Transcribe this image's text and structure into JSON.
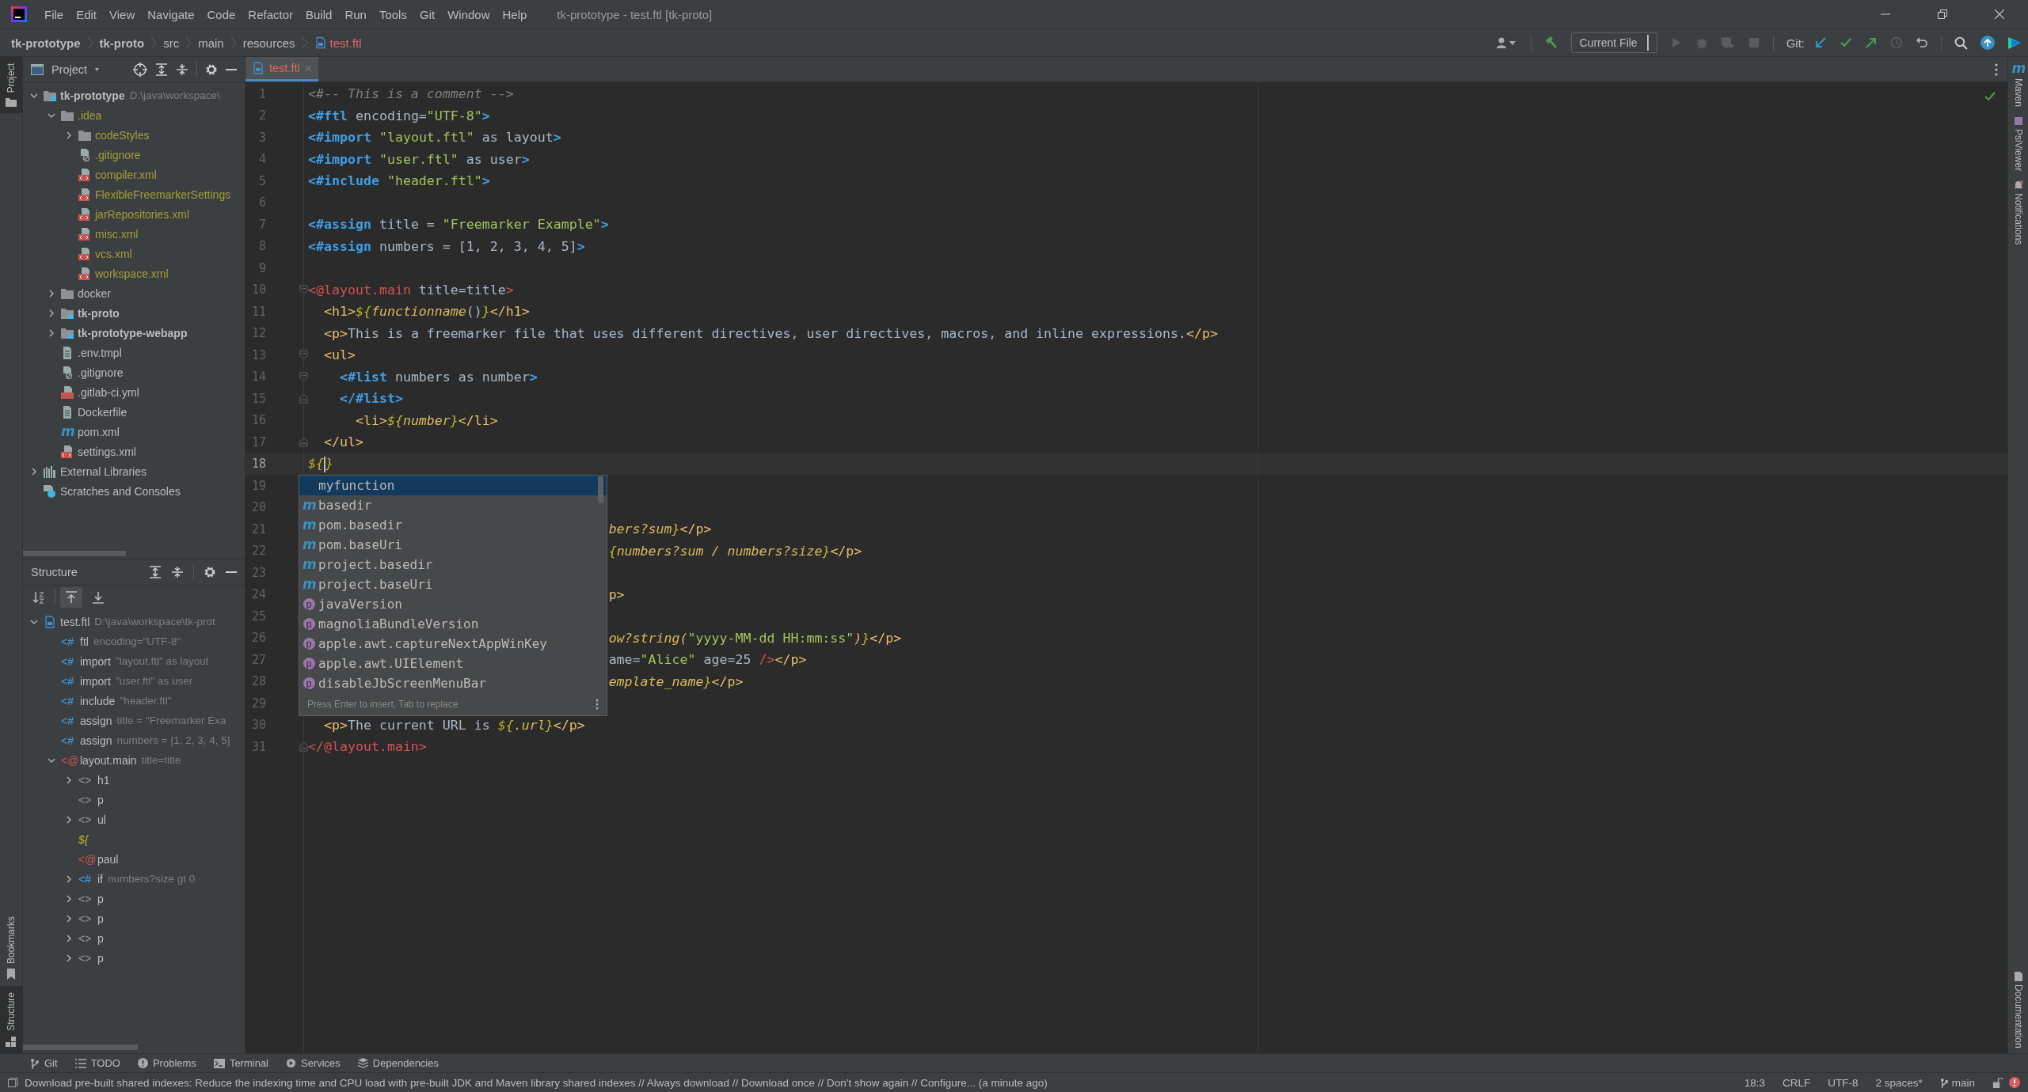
{
  "window": {
    "title": "tk-prototype - test.ftl [tk-proto]"
  },
  "menu": [
    "File",
    "Edit",
    "View",
    "Navigate",
    "Code",
    "Refactor",
    "Build",
    "Run",
    "Tools",
    "Git",
    "Window",
    "Help"
  ],
  "breadcrumb": [
    {
      "label": "tk-prototype",
      "kind": "module"
    },
    {
      "label": "tk-proto",
      "kind": "module"
    },
    {
      "label": "src",
      "kind": "folder"
    },
    {
      "label": "main",
      "kind": "folder"
    },
    {
      "label": "resources",
      "kind": "folder"
    },
    {
      "label": "test.ftl",
      "kind": "file"
    }
  ],
  "toolbar": {
    "run_config": "Current File",
    "git_label": "Git:"
  },
  "left_tool_windows": {
    "top": [
      {
        "label": "Project",
        "selected": true
      }
    ],
    "bottom": [
      {
        "label": "Bookmarks",
        "selected": false
      },
      {
        "label": "Structure",
        "selected": true
      }
    ]
  },
  "right_tool_windows": {
    "top": [
      {
        "label": "Maven",
        "glyph": "m"
      },
      {
        "label": "PsiViewer"
      },
      {
        "label": "Notifications"
      }
    ],
    "bottom": [
      {
        "label": "Documentation"
      }
    ]
  },
  "project": {
    "title": "Project",
    "tree": [
      {
        "label": "tk-prototype",
        "kind": "module",
        "detail": "D:\\java\\workspace\\",
        "expanded": true,
        "children": [
          {
            "label": ".idea",
            "kind": "folder",
            "ignored": true,
            "expanded": true,
            "children": [
              {
                "label": "codeStyles",
                "kind": "folder",
                "ignored": true,
                "expanded": false
              },
              {
                "label": ".gitignore",
                "kind": "gitignore",
                "ignored": true
              },
              {
                "label": "compiler.xml",
                "kind": "xml",
                "ignored": true
              },
              {
                "label": "FlexibleFreemarkerSettings",
                "kind": "xml",
                "ignored": true
              },
              {
                "label": "jarRepositories.xml",
                "kind": "xml",
                "ignored": true
              },
              {
                "label": "misc.xml",
                "kind": "xml",
                "ignored": true
              },
              {
                "label": "vcs.xml",
                "kind": "xml",
                "ignored": true
              },
              {
                "label": "workspace.xml",
                "kind": "xml",
                "ignored": true
              }
            ]
          },
          {
            "label": "docker",
            "kind": "folder",
            "ignored": false,
            "expanded": false
          },
          {
            "label": "tk-proto",
            "kind": "module",
            "expanded": false
          },
          {
            "label": "tk-prototype-webapp",
            "kind": "module",
            "expanded": false
          },
          {
            "label": ".env.tmpl",
            "kind": "file",
            "ignored": false
          },
          {
            "label": ".gitignore",
            "kind": "gitignore",
            "ignored": false
          },
          {
            "label": ".gitlab-ci.yml",
            "kind": "yml",
            "ignored": false
          },
          {
            "label": "Dockerfile",
            "kind": "file",
            "ignored": false
          },
          {
            "label": "pom.xml",
            "kind": "maven",
            "glyph": "m",
            "ignored": false
          },
          {
            "label": "settings.xml",
            "kind": "xml",
            "ignored": false
          }
        ]
      },
      {
        "label": "External Libraries",
        "kind": "libraries",
        "expanded": false
      },
      {
        "label": "Scratches and Consoles",
        "kind": "scratches"
      }
    ]
  },
  "structure": {
    "title": "Structure",
    "toggles": [
      {
        "kind": "sort",
        "selected": false
      },
      {
        "kind": "scroll-from",
        "selected": true
      },
      {
        "kind": "scroll-to",
        "selected": false
      }
    ],
    "tree": [
      {
        "kind": "file",
        "name": "test.ftl",
        "detail": "D:\\java\\workspace\\tk-prot",
        "expanded": true,
        "children": [
          {
            "prefix": "<#",
            "kind": "directive",
            "name": "ftl",
            "detail": "encoding=\"UTF-8\""
          },
          {
            "prefix": "<#",
            "kind": "directive",
            "name": "import",
            "detail": "\"layout.ftl\" as layout"
          },
          {
            "prefix": "<#",
            "kind": "directive",
            "name": "import",
            "detail": "\"user.ftl\" as user"
          },
          {
            "prefix": "<#",
            "kind": "directive",
            "name": "include",
            "detail": "\"header.ftl\""
          },
          {
            "prefix": "<#",
            "kind": "directive",
            "name": "assign",
            "detail": "title = \"Freemarker Exa"
          },
          {
            "prefix": "<#",
            "kind": "directive",
            "name": "assign",
            "detail": "numbers = [1, 2, 3, 4, 5]"
          },
          {
            "prefix": "<@",
            "kind": "macro",
            "name": "layout.main",
            "detail": "title=title",
            "expanded": true,
            "children": [
              {
                "prefix": "<>",
                "kind": "tag",
                "name": "h1",
                "expanded": false
              },
              {
                "prefix": "<>",
                "kind": "tag",
                "name": "p"
              },
              {
                "prefix": "<>",
                "kind": "tag",
                "name": "ul",
                "expanded": false
              },
              {
                "prefix": "${",
                "kind": "interp"
              },
              {
                "prefix": "<@",
                "kind": "macro",
                "name": "paul"
              },
              {
                "prefix": "<#",
                "kind": "directive",
                "name": "if",
                "detail": "numbers?size gt 0",
                "expanded": false
              },
              {
                "prefix": "<>",
                "kind": "tag",
                "name": "p",
                "expanded": false
              },
              {
                "prefix": "<>",
                "kind": "tag",
                "name": "p",
                "expanded": false
              },
              {
                "prefix": "<>",
                "kind": "tag",
                "name": "p",
                "expanded": false
              },
              {
                "prefix": "<>",
                "kind": "tag",
                "name": "p",
                "expanded": false
              }
            ]
          }
        ]
      }
    ]
  },
  "editor": {
    "tabs": [
      {
        "label": "test.ftl",
        "selected": true
      }
    ],
    "lines": [
      {
        "number": "1",
        "current": false,
        "segments": [
          {
            "kind": "comment",
            "text": "<#-- This is a comment -->"
          }
        ]
      },
      {
        "number": "2",
        "current": false,
        "segments": [
          {
            "kind": "directive",
            "text": "<#ftl"
          },
          {
            "kind": "plain",
            "text": " encoding="
          },
          {
            "kind": "string",
            "text": "\"UTF-8\""
          },
          {
            "kind": "directive",
            "text": ">"
          }
        ]
      },
      {
        "number": "3",
        "current": false,
        "segments": [
          {
            "kind": "directive",
            "text": "<#import"
          },
          {
            "kind": "string",
            "text": " \"layout.ftl\""
          },
          {
            "kind": "plain",
            "text": " as layout"
          },
          {
            "kind": "directive",
            "text": ">"
          }
        ]
      },
      {
        "number": "4",
        "current": false,
        "segments": [
          {
            "kind": "directive",
            "text": "<#import"
          },
          {
            "kind": "string",
            "text": " \"user.ftl\""
          },
          {
            "kind": "plain",
            "text": " as user"
          },
          {
            "kind": "directive",
            "text": ">"
          }
        ]
      },
      {
        "number": "5",
        "current": false,
        "segments": [
          {
            "kind": "directive",
            "text": "<#include"
          },
          {
            "kind": "string",
            "text": " \"header.ftl\""
          },
          {
            "kind": "directive",
            "text": ">"
          }
        ]
      },
      {
        "number": "6",
        "current": false
      },
      {
        "number": "7",
        "current": false,
        "segments": [
          {
            "kind": "directive",
            "text": "<#assign"
          },
          {
            "kind": "plain",
            "text": " title = "
          },
          {
            "kind": "string",
            "text": "\"Freemarker Example\""
          },
          {
            "kind": "directive",
            "text": ">"
          }
        ]
      },
      {
        "number": "8",
        "current": false,
        "segments": [
          {
            "kind": "directive",
            "text": "<#assign"
          },
          {
            "kind": "plain",
            "text": " numbers = [1, 2, 3, 4, 5]"
          },
          {
            "kind": "directive",
            "text": ">"
          }
        ]
      },
      {
        "number": "9",
        "current": false
      },
      {
        "number": "10",
        "current": false,
        "fold": {
          "kind": "start"
        },
        "segments": [
          {
            "kind": "macro",
            "text": "<@layout.main"
          },
          {
            "kind": "plain",
            "text": " title=title"
          },
          {
            "kind": "macro",
            "text": ">"
          }
        ]
      },
      {
        "number": "11",
        "current": false,
        "segments": [
          {
            "kind": "tag",
            "text": "  <h1>"
          },
          {
            "kind": "interp",
            "text": "${"
          },
          {
            "kind": "expr",
            "text": "functionname"
          },
          {
            "kind": "plain",
            "text": "()"
          },
          {
            "kind": "interp",
            "text": "}"
          },
          {
            "kind": "tag",
            "text": "</h1>"
          }
        ]
      },
      {
        "number": "12",
        "current": false,
        "segments": [
          {
            "kind": "tag",
            "text": "  <p>"
          },
          {
            "kind": "plain",
            "text": "This is a freemarker file that uses different directives, user directives, macros, and inline expressions."
          },
          {
            "kind": "tag",
            "text": "</p>"
          }
        ]
      },
      {
        "number": "13",
        "current": false,
        "fold": {
          "kind": "start"
        },
        "segments": [
          {
            "kind": "tag",
            "text": "  <ul>"
          }
        ]
      },
      {
        "number": "14",
        "current": false,
        "fold": {
          "kind": "start"
        },
        "segments": [
          {
            "kind": "directive",
            "text": "    <#list"
          },
          {
            "kind": "plain",
            "text": " numbers as number"
          },
          {
            "kind": "directive",
            "text": ">"
          }
        ]
      },
      {
        "number": "15",
        "current": false,
        "fold": {
          "kind": "end"
        },
        "segments": [
          {
            "kind": "directive",
            "text": "    </#list>"
          }
        ]
      },
      {
        "number": "16",
        "current": false,
        "segments": [
          {
            "kind": "tag",
            "text": "      <li>"
          },
          {
            "kind": "interp",
            "text": "${"
          },
          {
            "kind": "expr",
            "text": "number"
          },
          {
            "kind": "interp",
            "text": "}"
          },
          {
            "kind": "tag",
            "text": "</li>"
          }
        ]
      },
      {
        "number": "17",
        "current": false,
        "fold": {
          "kind": "end"
        },
        "segments": [
          {
            "kind": "tag",
            "text": "  </ul>"
          }
        ]
      },
      {
        "number": "18",
        "current": true,
        "segments": [
          {
            "kind": "interp",
            "text": "${"
          },
          {
            "kind": "cursor"
          },
          {
            "kind": "interp",
            "text": "}"
          }
        ]
      },
      {
        "number": "19",
        "current": false
      },
      {
        "number": "20",
        "current": false
      },
      {
        "number": "21",
        "current": false,
        "segments": [
          {
            "kind": "expr",
            "text": "                                      bers?sum"
          },
          {
            "kind": "interp",
            "text": "}"
          },
          {
            "kind": "tag",
            "text": "</p>"
          }
        ]
      },
      {
        "number": "22",
        "current": false,
        "segments": [
          {
            "kind": "interp",
            "text": "                                      {"
          },
          {
            "kind": "expr",
            "text": "numbers?sum / numbers?size"
          },
          {
            "kind": "interp",
            "text": "}"
          },
          {
            "kind": "tag",
            "text": "</p>"
          }
        ]
      },
      {
        "number": "23",
        "current": false
      },
      {
        "number": "24",
        "current": false,
        "segments": [
          {
            "kind": "tag",
            "text": "                                      p>"
          }
        ]
      },
      {
        "number": "25",
        "current": false
      },
      {
        "number": "26",
        "current": false,
        "segments": [
          {
            "kind": "expr",
            "text": "                                      ow?string("
          },
          {
            "kind": "string",
            "text": "\"yyyy-MM-dd HH:mm:ss\""
          },
          {
            "kind": "expr",
            "text": ")"
          },
          {
            "kind": "interp",
            "text": "}"
          },
          {
            "kind": "tag",
            "text": "</p>"
          }
        ]
      },
      {
        "number": "27",
        "current": false,
        "segments": [
          {
            "kind": "plain",
            "text": "                                      ame="
          },
          {
            "kind": "string",
            "text": "\"Alice\""
          },
          {
            "kind": "plain",
            "text": " age=25 "
          },
          {
            "kind": "macro",
            "text": "/>"
          },
          {
            "kind": "tag",
            "text": "</p>"
          }
        ]
      },
      {
        "number": "28",
        "current": false,
        "segments": [
          {
            "kind": "expr",
            "text": "                                      emplate_name"
          },
          {
            "kind": "interp",
            "text": "}"
          },
          {
            "kind": "tag",
            "text": "</p>"
          }
        ]
      },
      {
        "number": "29",
        "current": false
      },
      {
        "number": "30",
        "current": false,
        "segments": [
          {
            "kind": "tag",
            "text": "  <p>"
          },
          {
            "kind": "plain",
            "text": "The current URL is "
          },
          {
            "kind": "interp",
            "text": "${"
          },
          {
            "kind": "expr",
            "text": ".url"
          },
          {
            "kind": "interp",
            "text": "}"
          },
          {
            "kind": "tag",
            "text": "</p>"
          }
        ]
      },
      {
        "number": "31",
        "current": false,
        "fold": {
          "kind": "end"
        },
        "segments": [
          {
            "kind": "macro",
            "text": "</@layout.main>"
          }
        ]
      }
    ],
    "completion": {
      "hint": "Press Enter to insert, Tab to replace",
      "items": [
        {
          "label": "myfunction",
          "kind": "function",
          "selected": true
        },
        {
          "label": "basedir",
          "kind": "maven",
          "glyph": "m",
          "selected": false
        },
        {
          "label": "pom.basedir",
          "kind": "maven",
          "glyph": "m",
          "selected": false
        },
        {
          "label": "pom.baseUri",
          "kind": "maven",
          "glyph": "m",
          "selected": false
        },
        {
          "label": "project.basedir",
          "kind": "maven",
          "glyph": "m",
          "selected": false
        },
        {
          "label": "project.baseUri",
          "kind": "maven",
          "glyph": "m",
          "selected": false
        },
        {
          "label": "javaVersion",
          "kind": "property",
          "glyph": "p",
          "selected": false
        },
        {
          "label": "magnoliaBundleVersion",
          "kind": "property",
          "glyph": "p",
          "selected": false
        },
        {
          "label": "apple.awt.captureNextAppWinKey",
          "kind": "property",
          "glyph": "p",
          "selected": false
        },
        {
          "label": "apple.awt.UIElement",
          "kind": "property",
          "glyph": "p",
          "selected": false
        },
        {
          "label": "disableJbScreenMenuBar",
          "kind": "property",
          "glyph": "p",
          "selected": false
        }
      ]
    }
  },
  "bottom_tools": [
    {
      "label": "Git",
      "kind": "git"
    },
    {
      "label": "TODO",
      "kind": "todo"
    },
    {
      "label": "Problems",
      "kind": "problems"
    },
    {
      "label": "Terminal",
      "kind": "terminal"
    },
    {
      "label": "Services",
      "kind": "services"
    },
    {
      "label": "Dependencies",
      "kind": "dependencies"
    }
  ],
  "status_bar": {
    "message": "Download pre-built shared indexes: Reduce the indexing time and CPU load with pre-built JDK and Maven library shared indexes // Always download // Download once // Don't show again // Configure... (a minute ago)",
    "items": [
      {
        "label": "18:3",
        "kind": "text"
      },
      {
        "label": "CRLF",
        "kind": "text"
      },
      {
        "label": "UTF-8",
        "kind": "text"
      },
      {
        "label": "2 spaces*",
        "kind": "text"
      },
      {
        "label": "main",
        "kind": "branch"
      }
    ]
  }
}
